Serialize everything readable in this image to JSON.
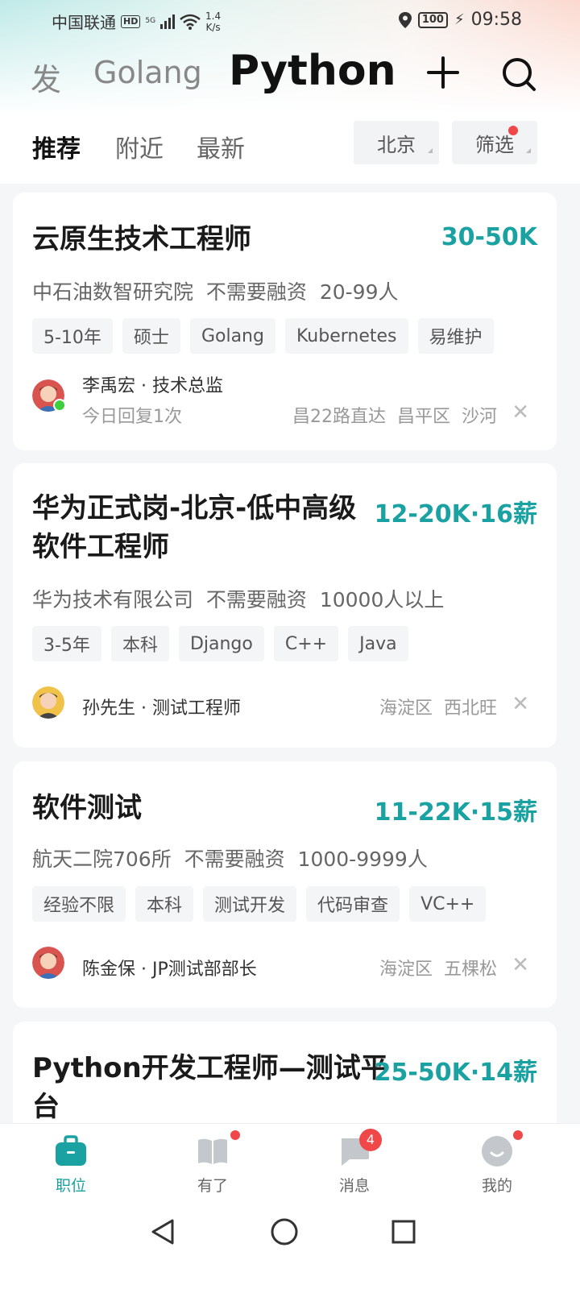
{
  "status_bar": {
    "carrier": "中国联通",
    "hd": "HD",
    "signal": "5G",
    "speed_value": "1.4",
    "speed_unit": "K/s",
    "battery": "100",
    "time": "09:58"
  },
  "header": {
    "categories": [
      "发",
      "Golang"
    ],
    "active_category": "Python",
    "add_icon": "plus-icon",
    "search_icon": "search-icon"
  },
  "tabs": {
    "items": [
      "推荐",
      "附近",
      "最新"
    ],
    "city": "北京",
    "filter": "筛选"
  },
  "jobs": [
    {
      "title": "云原生技术工程师",
      "salary": "30-50K",
      "company": "中石油数智研究院",
      "funding": "不需要融资",
      "size": "20-99人",
      "tags": [
        "5-10年",
        "硕士",
        "Golang",
        "Kubernetes",
        "易维护"
      ],
      "recruiter": "李禹宏 · 技术总监",
      "reply": "今日回复1次",
      "location": "昌22路直达  昌平区  沙河"
    },
    {
      "title_line1": "华为正式岗-北京-低中高级",
      "title_line2": "软件工程师",
      "salary": "12-20K·16薪",
      "company": "华为技术有限公司",
      "funding": "不需要融资",
      "size": "10000人以上",
      "tags": [
        "3-5年",
        "本科",
        "Django",
        "C++",
        "Java"
      ],
      "recruiter": "孙先生 · 测试工程师",
      "location": "海淀区  西北旺"
    },
    {
      "title": "软件测试",
      "salary": "11-22K·15薪",
      "company": "航天二院706所",
      "funding": "不需要融资",
      "size": "1000-9999人",
      "tags": [
        "经验不限",
        "本科",
        "测试开发",
        "代码审查",
        "VC++"
      ],
      "recruiter": "陈金保 · JP测试部部长",
      "location": "海淀区  五棵松"
    },
    {
      "title_line1": "Python开发工程师—测试平",
      "title_line2": "台",
      "salary": "25-50K·14薪"
    }
  ],
  "close_glyph": "✕",
  "bottom_nav": {
    "items": [
      {
        "label": "职位",
        "icon": "briefcase-icon"
      },
      {
        "label": "有了",
        "icon": "book-icon"
      },
      {
        "label": "消息",
        "icon": "chat-icon",
        "badge": "4"
      },
      {
        "label": "我的",
        "icon": "profile-icon"
      }
    ]
  },
  "system_nav": [
    "back-icon",
    "home-icon",
    "recents-icon"
  ],
  "colors": {
    "accent": "#1aa2a2",
    "badge_red": "#f04848",
    "online_green": "#3ecf3e"
  }
}
